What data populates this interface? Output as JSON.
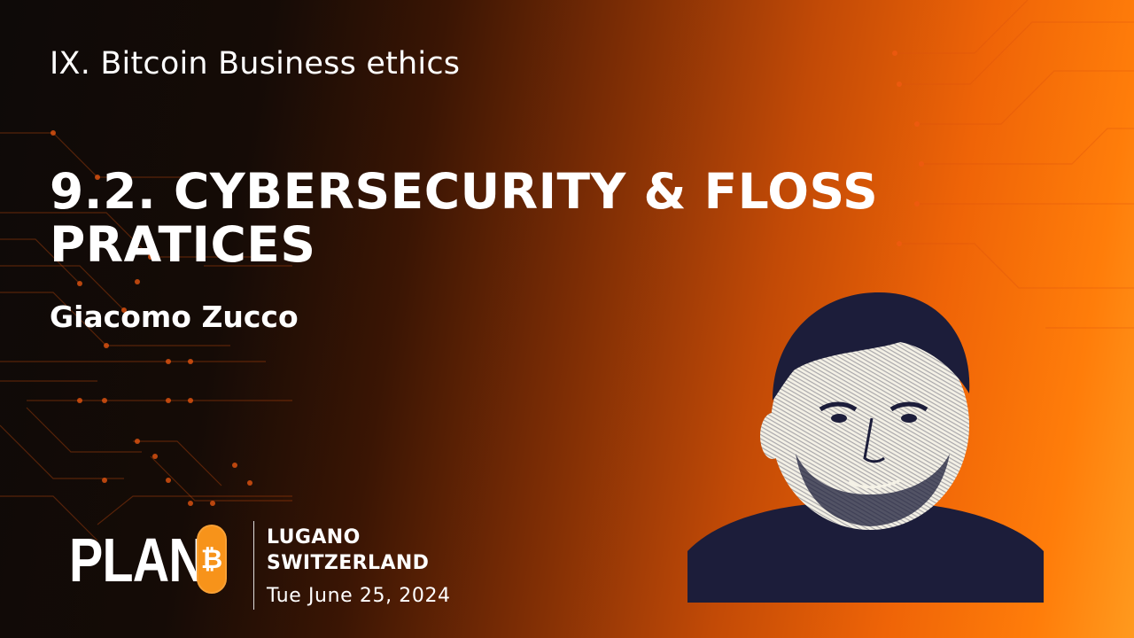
{
  "slide": {
    "chapter": "IX. Bitcoin Business ethics",
    "title": "9.2. CYBERSECURITY & FLOSS PRATICES",
    "speaker": "Giacomo Zucco"
  },
  "branding": {
    "logo_text": "PLAN",
    "logo_symbol": "₿",
    "location_line1": "LUGANO",
    "location_line2": "SWITZERLAND",
    "date": "Tue June 25, 2024"
  },
  "colors": {
    "accent": "#f7931a",
    "background_dark": "#0e0a08",
    "background_orange": "#ff7d0a",
    "portrait_ink": "#1c1d3a"
  },
  "icons": {
    "logo": "plan-b-bitcoin-logo",
    "portrait": "speaker-portrait"
  }
}
